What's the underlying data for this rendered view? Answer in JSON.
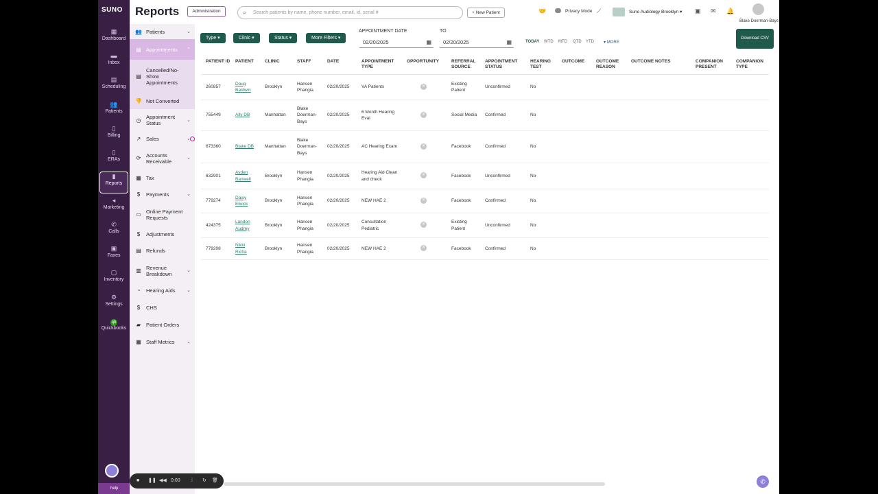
{
  "brand": "SUNO",
  "page_title": "Reports",
  "header": {
    "admin_label": "Administration",
    "search_placeholder": "Search patients by name, phone number, email, id, serial #",
    "new_patient_label": "+ New Patient",
    "privacy_label": "Privacy Mode",
    "clinic_label": "Suno Audiology Brooklyn",
    "user_name": "Blake Doerman-Bays"
  },
  "rail": [
    {
      "label": "Dashboard",
      "icon": "dashboard-icon"
    },
    {
      "label": "Inbox",
      "icon": "inbox-icon"
    },
    {
      "label": "Scheduling",
      "icon": "calendar-icon"
    },
    {
      "label": "Patients",
      "icon": "patients-icon"
    },
    {
      "label": "Billing",
      "icon": "billing-icon"
    },
    {
      "label": "ERAs",
      "icon": "document-icon"
    },
    {
      "label": "Reports",
      "icon": "bar-chart-icon"
    },
    {
      "label": "Marketing",
      "icon": "megaphone-icon"
    },
    {
      "label": "Calls",
      "icon": "phone-icon"
    },
    {
      "label": "Faxes",
      "icon": "fax-icon"
    },
    {
      "label": "Inventory",
      "icon": "inventory-icon"
    },
    {
      "label": "Settings",
      "icon": "gear-icon"
    },
    {
      "label": "Quickbooks",
      "icon": "quickbooks-icon"
    }
  ],
  "submenu": [
    {
      "label": "Patients",
      "icon": "patients-icon"
    },
    {
      "label": "Appointments",
      "icon": "calendar-icon"
    },
    {
      "label": "Cancelled/No-Show Appointments",
      "icon": "calendar-x-icon"
    },
    {
      "label": "Not Converted",
      "icon": "thumbs-down-icon"
    },
    {
      "label": "Appointment Status",
      "icon": "clock-icon"
    },
    {
      "label": "Sales",
      "icon": "trend-icon"
    },
    {
      "label": "Accounts Receivable",
      "icon": "refresh-icon"
    },
    {
      "label": "Tax",
      "icon": "calculator-icon"
    },
    {
      "label": "Payments",
      "icon": "dollar-circle-icon"
    },
    {
      "label": "Online Payment Requests",
      "icon": "credit-card-icon"
    },
    {
      "label": "Adjustments",
      "icon": "dollar-circle-icon"
    },
    {
      "label": "Refunds",
      "icon": "refund-icon"
    },
    {
      "label": "Revenue Breakdown",
      "icon": "building-icon"
    },
    {
      "label": "Hearing Aids",
      "icon": "hearing-aid-icon"
    },
    {
      "label": "CHS",
      "icon": "dollar-icon"
    },
    {
      "label": "Patient Orders",
      "icon": "truck-icon"
    },
    {
      "label": "Staff Metrics",
      "icon": "grid-icon"
    }
  ],
  "filters": {
    "type": "Type",
    "clinic": "Clinic",
    "status": "Status",
    "more": "More Filters",
    "date_label": "APPOINTMENT DATE",
    "to_label": "TO",
    "from_date": "02/20/2025",
    "to_date": "02/20/2025",
    "ranges": [
      "TODAY",
      "WTD",
      "MTD",
      "QTD",
      "YTD"
    ],
    "more_label": "MORE",
    "download": "Download CSV"
  },
  "table": {
    "headers": [
      "PATIENT ID",
      "PATIENT",
      "CLINIC",
      "STAFF",
      "DATE",
      "APPOINTMENT TYPE",
      "OPPORTUNITY",
      "REFERRAL SOURCE",
      "APPOINTMENT STATUS",
      "HEARING TEST",
      "OUTCOME",
      "OUTCOME REASON",
      "OUTCOME NOTES",
      "COMPANION PRESENT",
      "COMPANION TYPE"
    ],
    "rows": [
      {
        "id": "260857",
        "patient": "Doug Baldwin",
        "clinic": "Brooklyn",
        "staff": "Hansen Phangia",
        "date": "02/20/2025",
        "type": "VA Patients",
        "referral": "Existing Patient",
        "status": "Unconfirmed",
        "hearing": "No"
      },
      {
        "id": "755449",
        "patient": "Ally DB",
        "clinic": "Manhattan",
        "staff": "Blake Doerman-Bays",
        "date": "02/20/2025",
        "type": "6 Month Hearing Eval",
        "referral": "Social Media",
        "status": "Confirmed",
        "hearing": "No"
      },
      {
        "id": "673360",
        "patient": "Blake DB",
        "clinic": "Manhattan",
        "staff": "Blake Doerman-Bays",
        "date": "02/20/2025",
        "type": "AC Hearing Exam",
        "referral": "Facebook",
        "status": "Confirmed",
        "hearing": "No"
      },
      {
        "id": "632901",
        "patient": "Ayden Banwell",
        "clinic": "Brooklyn",
        "staff": "Hansen Phangia",
        "date": "02/20/2025",
        "type": "Hearing Aid Clean and check",
        "referral": "Facebook",
        "status": "Unconfirmed",
        "hearing": "No"
      },
      {
        "id": "779274",
        "patient": "Daisy Elwick",
        "clinic": "Brooklyn",
        "staff": "Hansen Phangia",
        "date": "02/20/2025",
        "type": "NEW HAE 2",
        "referral": "Facebook",
        "status": "Confirmed",
        "hearing": "No"
      },
      {
        "id": "424375",
        "patient": "Landon Audrey",
        "clinic": "Brooklyn",
        "staff": "Hansen Phangia",
        "date": "02/20/2025",
        "type": "Consultation Pediatric",
        "referral": "Existing Patient",
        "status": "Unconfirmed",
        "hearing": "No"
      },
      {
        "id": "779208",
        "patient": "Nikki Richa",
        "clinic": "Brooklyn",
        "staff": "Hansen Phangia",
        "date": "02/20/2025",
        "type": "NEW HAE 2",
        "referral": "Facebook",
        "status": "Confirmed",
        "hearing": "No"
      }
    ]
  },
  "help_label": "help",
  "recorder_time": "0:00",
  "colors": {
    "rail": "#3a1f45",
    "accent": "#1f5a4c",
    "active_sub": "#d9b8e3"
  }
}
